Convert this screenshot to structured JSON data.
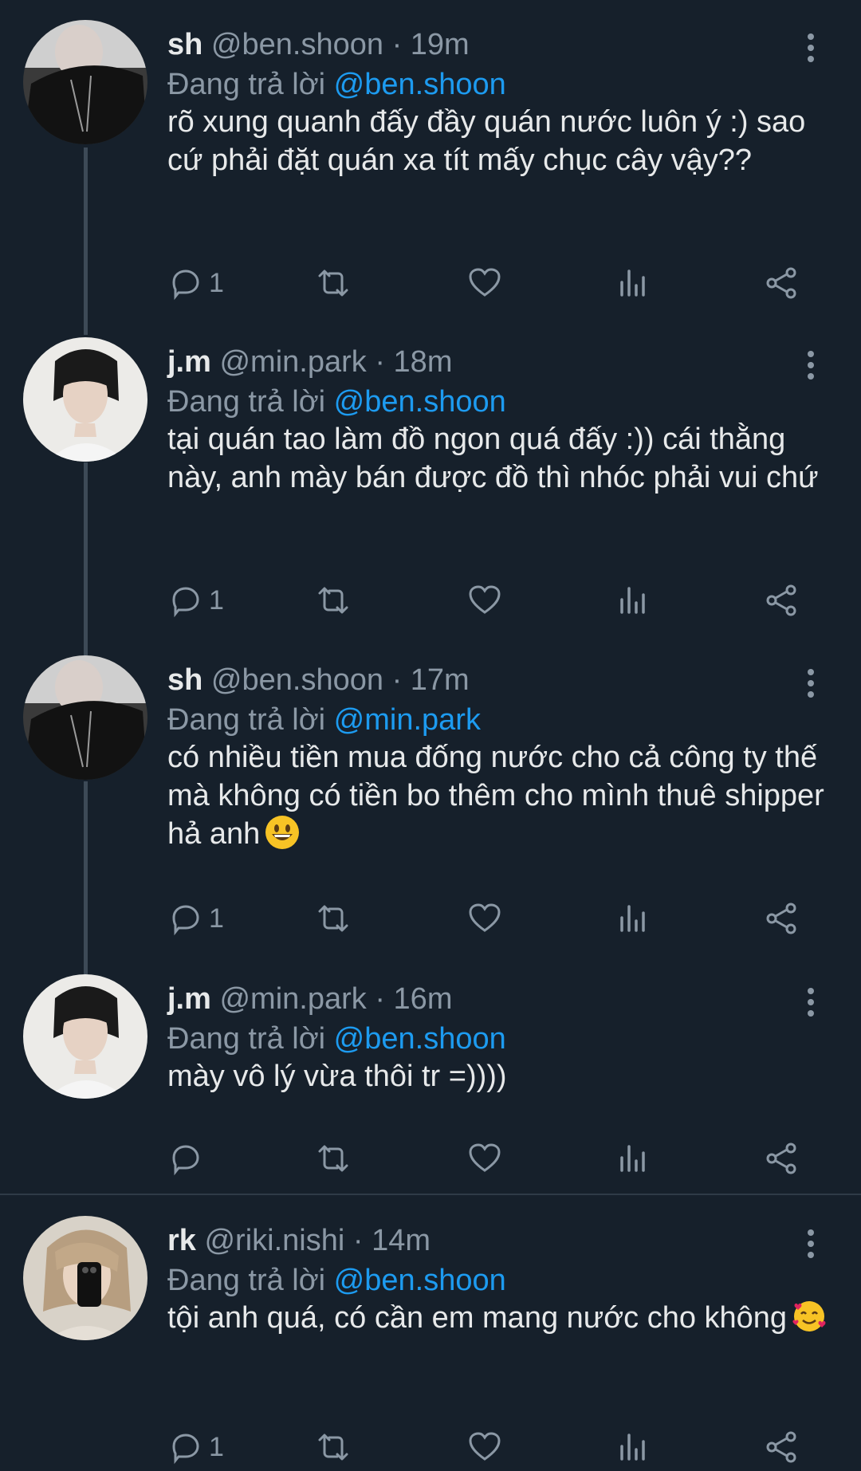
{
  "labels": {
    "replying_to": "Đang trả lời",
    "separator": "·"
  },
  "colors": {
    "background": "#16202b",
    "mention": "#1d9bf0",
    "muted": "#8b98a5"
  },
  "tweets": [
    {
      "name": "sh",
      "handle": "@ben.shoon",
      "time": "19m",
      "reply_to": "@ben.shoon",
      "text": "rõ xung quanh đấy đầy quán nước luôn ý :) sao cứ phải đặt quán xa tít mấy chục cây vậy??",
      "reply_count": "1",
      "avatar": "dark-jacket-portrait"
    },
    {
      "name": "j.m",
      "handle": "@min.park",
      "time": "18m",
      "reply_to": "@ben.shoon",
      "text": "tại quán tao làm đồ ngon quá đấy :)) cái thằng này, anh mày bán được đồ thì nhóc phải vui chứ",
      "reply_count": "1",
      "avatar": "light-portrait"
    },
    {
      "name": "sh",
      "handle": "@ben.shoon",
      "time": "17m",
      "reply_to": "@min.park",
      "text": "có nhiều tiền mua đống nước cho cả công ty thế mà không có tiền bo thêm cho mình thuê shipper hả anh",
      "reply_count": "1",
      "avatar": "dark-jacket-portrait",
      "emoji": "grinning-face-emoji"
    },
    {
      "name": "j.m",
      "handle": "@min.park",
      "time": "16m",
      "reply_to": "@ben.shoon",
      "text": "mày vô lý vừa thôi tr =))))",
      "reply_count": "",
      "avatar": "light-portrait"
    },
    {
      "name": "rk",
      "handle": "@riki.nishi",
      "time": "14m",
      "reply_to": "@ben.shoon",
      "text": "tội anh quá, có cần em mang nước cho không",
      "reply_count": "1",
      "avatar": "mirror-selfie-portrait",
      "emoji": "smiling-face-with-hearts-emoji"
    }
  ]
}
